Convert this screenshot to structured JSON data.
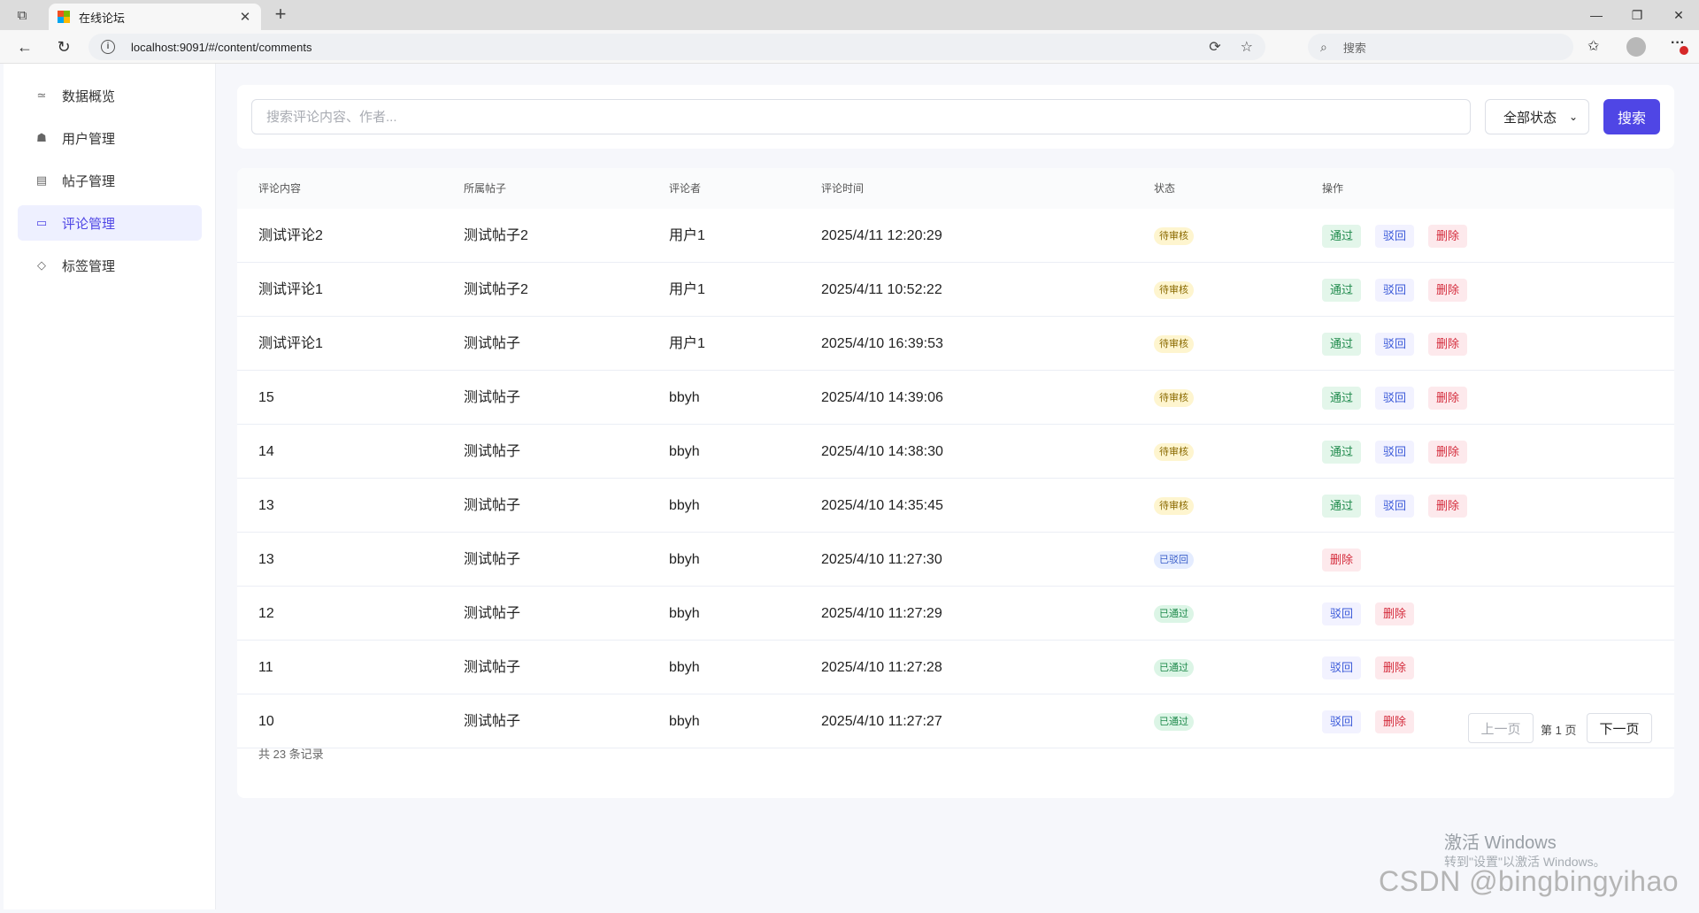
{
  "browser": {
    "tab_title": "在线论坛",
    "url": "localhost:9091/#/content/comments",
    "search_placeholder": "搜索"
  },
  "sidebar": {
    "items": [
      {
        "label": "数据概览",
        "icon": "chart-icon"
      },
      {
        "label": "用户管理",
        "icon": "users-icon"
      },
      {
        "label": "帖子管理",
        "icon": "document-icon"
      },
      {
        "label": "评论管理",
        "icon": "comment-icon",
        "active": true
      },
      {
        "label": "标签管理",
        "icon": "tag-icon"
      }
    ]
  },
  "search": {
    "placeholder": "搜索评论内容、作者...",
    "status_selected": "全部状态",
    "button_label": "搜索"
  },
  "table": {
    "headers": [
      "评论内容",
      "所属帖子",
      "评论者",
      "评论时间",
      "状态",
      "操作"
    ],
    "rows": [
      {
        "content": "测试评论2",
        "post": "测试帖子2",
        "author": "用户1",
        "time": "2025/4/11 12:20:29",
        "status": "待审核",
        "status_type": "pending",
        "actions": [
          "通过",
          "驳回",
          "删除"
        ]
      },
      {
        "content": "测试评论1",
        "post": "测试帖子2",
        "author": "用户1",
        "time": "2025/4/11 10:52:22",
        "status": "待审核",
        "status_type": "pending",
        "actions": [
          "通过",
          "驳回",
          "删除"
        ]
      },
      {
        "content": "测试评论1",
        "post": "测试帖子",
        "author": "用户1",
        "time": "2025/4/10 16:39:53",
        "status": "待审核",
        "status_type": "pending",
        "actions": [
          "通过",
          "驳回",
          "删除"
        ]
      },
      {
        "content": "15",
        "post": "测试帖子",
        "author": "bbyh",
        "time": "2025/4/10 14:39:06",
        "status": "待审核",
        "status_type": "pending",
        "actions": [
          "通过",
          "驳回",
          "删除"
        ]
      },
      {
        "content": "14",
        "post": "测试帖子",
        "author": "bbyh",
        "time": "2025/4/10 14:38:30",
        "status": "待审核",
        "status_type": "pending",
        "actions": [
          "通过",
          "驳回",
          "删除"
        ]
      },
      {
        "content": "13",
        "post": "测试帖子",
        "author": "bbyh",
        "time": "2025/4/10 14:35:45",
        "status": "待审核",
        "status_type": "pending",
        "actions": [
          "通过",
          "驳回",
          "删除"
        ]
      },
      {
        "content": "13",
        "post": "测试帖子",
        "author": "bbyh",
        "time": "2025/4/10 11:27:30",
        "status": "已驳回",
        "status_type": "rejected",
        "actions": [
          "删除"
        ]
      },
      {
        "content": "12",
        "post": "测试帖子",
        "author": "bbyh",
        "time": "2025/4/10 11:27:29",
        "status": "已通过",
        "status_type": "approved",
        "actions": [
          "驳回",
          "删除"
        ]
      },
      {
        "content": "11",
        "post": "测试帖子",
        "author": "bbyh",
        "time": "2025/4/10 11:27:28",
        "status": "已通过",
        "status_type": "approved",
        "actions": [
          "驳回",
          "删除"
        ]
      },
      {
        "content": "10",
        "post": "测试帖子",
        "author": "bbyh",
        "time": "2025/4/10 11:27:27",
        "status": "已通过",
        "status_type": "approved",
        "actions": [
          "驳回",
          "删除"
        ]
      }
    ]
  },
  "pagination": {
    "total": "共 23 条记录",
    "prev": "上一页",
    "current": "第 1 页",
    "next": "下一页"
  },
  "overlay": {
    "activate_title": "激活 Windows",
    "activate_sub": "转到\"设置\"以激活 Windows。",
    "csdn": "CSDN @bingbingyihao"
  },
  "colors": {
    "accent": "#4f46e5",
    "pending_bg": "#fef5cf",
    "approved_bg": "#dcf5e6",
    "rejected_bg": "#e4ecff",
    "delete_text": "#d42c3c"
  }
}
